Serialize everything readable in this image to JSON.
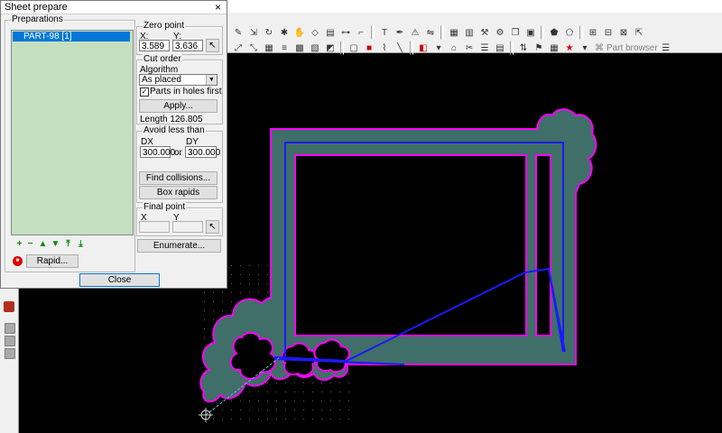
{
  "dialog": {
    "title": "Sheet prepare",
    "close_glyph": "×",
    "preparations": {
      "label": "Preparations",
      "items": [
        "PART-98  [1]"
      ]
    },
    "zero_point": {
      "label": "Zero point",
      "x_label": "X:",
      "y_label": "Y:",
      "x_value": "3.589",
      "y_value": "3.636"
    },
    "cut_order": {
      "label": "Cut order",
      "algorithm_label": "Algorithm",
      "algorithm_value": "As placed",
      "parts_in_holes_first": "Parts in holes first",
      "apply_label": "Apply...",
      "length_text": "Length  126.805"
    },
    "avoid_less_than": {
      "label": "Avoid less than",
      "dx_label": "DX",
      "dy_label": "DY",
      "or_label": "or",
      "dx_value": "300.000",
      "dy_value": "300.000",
      "find_collisions_label": "Find collisions...",
      "box_rapids_label": "Box rapids"
    },
    "final_point": {
      "label": "Final point",
      "x_label": "X",
      "y_label": "Y",
      "x_value": "",
      "y_value": ""
    },
    "enumerate_label": "Enumerate...",
    "rapid_label": "Rapid...",
    "close_label": "Close"
  },
  "toolbar": {
    "part_browser_label": "Part browser"
  },
  "colors": {
    "canvas_bg": "#000000",
    "part_fill": "#3f6f68",
    "part_outline": "#ff00ff",
    "toolpath": "#1a1aff",
    "list_bg": "#c5e0c0",
    "selection": "#0078d7"
  }
}
